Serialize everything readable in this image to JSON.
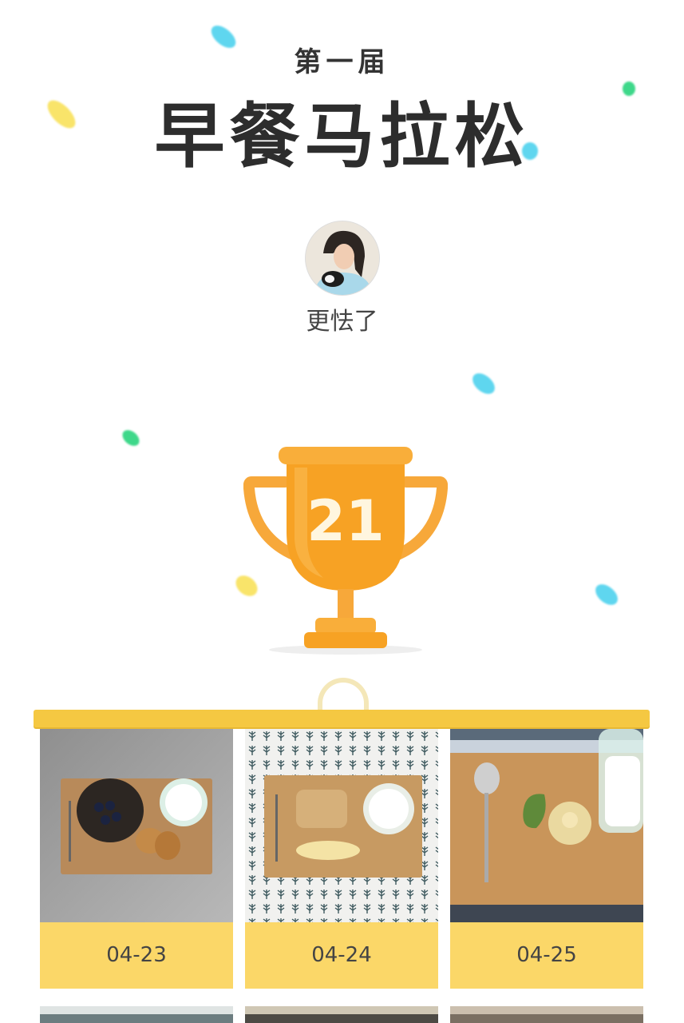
{
  "header": {
    "edition": "第一届",
    "title": "早餐马拉松"
  },
  "user": {
    "name": "更怯了"
  },
  "trophy": {
    "count": "21",
    "color": "#f7a224"
  },
  "entries": [
    {
      "date": "04-23"
    },
    {
      "date": "04-24"
    },
    {
      "date": "04-25"
    }
  ],
  "colors": {
    "accent": "#f5c842",
    "card": "#fbd768"
  }
}
